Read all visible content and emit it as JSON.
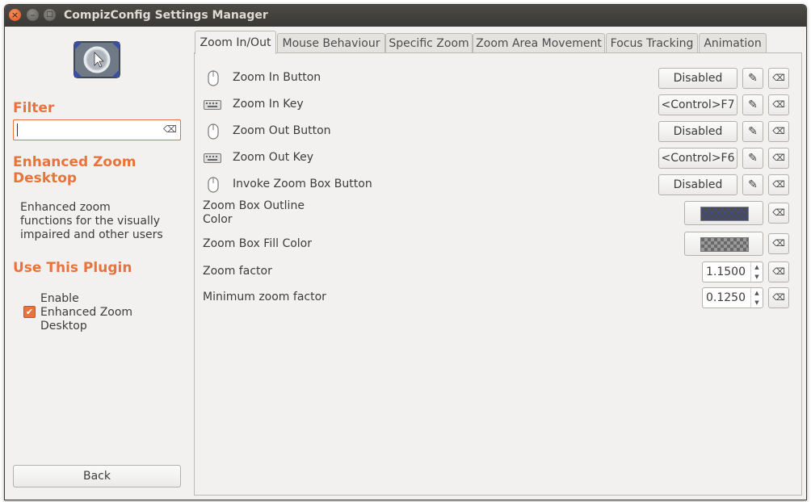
{
  "window": {
    "title": "CompizConfig Settings Manager",
    "controls": {
      "close": "×",
      "minimize": "–",
      "maximize": "□"
    }
  },
  "sidebar": {
    "plugin_icon": "zoom-plugin-icon",
    "filter_heading": "Filter",
    "filter_value": "",
    "plugin_heading_line1": "Enhanced Zoom",
    "plugin_heading_line2": "Desktop",
    "description_line1": "Enhanced zoom",
    "description_line2": "functions for the visually",
    "description_line3": "impaired and other users",
    "use_heading": "Use This Plugin",
    "enable_checked": true,
    "enable_label_line1": "Enable",
    "enable_label_line2": "Enhanced Zoom",
    "enable_label_line3": "Desktop",
    "back_label": "Back"
  },
  "tabs": [
    {
      "label": "Zoom In/Out",
      "active": true
    },
    {
      "label": "Mouse Behaviour",
      "active": false
    },
    {
      "label": "Specific Zoom",
      "active": false
    },
    {
      "label": "Zoom Area Movement",
      "active": false
    },
    {
      "label": "Focus Tracking",
      "active": false
    },
    {
      "label": "Animation",
      "active": false
    }
  ],
  "settings": [
    {
      "label": "Zoom In Button",
      "type": "button-binding",
      "icon": "mouse-icon",
      "value": "Disabled"
    },
    {
      "label": "Zoom In Key",
      "type": "key-binding",
      "icon": "keyboard-icon",
      "value": "<Control>F7"
    },
    {
      "label": "Zoom Out Button",
      "type": "button-binding",
      "icon": "mouse-icon",
      "value": "Disabled"
    },
    {
      "label": "Zoom Out Key",
      "type": "key-binding",
      "icon": "keyboard-icon",
      "value": "<Control>F6"
    },
    {
      "label": "Invoke Zoom Box Button",
      "type": "button-binding",
      "icon": "mouse-icon",
      "value": "Disabled"
    },
    {
      "label_line1": "Zoom Box Outline",
      "label_line2": "Color",
      "type": "color",
      "value": "#2f3a6f"
    },
    {
      "label": "Zoom Box Fill Color",
      "type": "color",
      "value": "#6a6a6a"
    },
    {
      "label": "Zoom factor",
      "type": "spin",
      "value": "1.1500"
    },
    {
      "label": "Minimum zoom factor",
      "type": "spin",
      "value": "0.1250"
    }
  ],
  "colors": {
    "accent": "#e9743b",
    "titlebar": "#3c3b37",
    "background": "#f2f1f0"
  }
}
